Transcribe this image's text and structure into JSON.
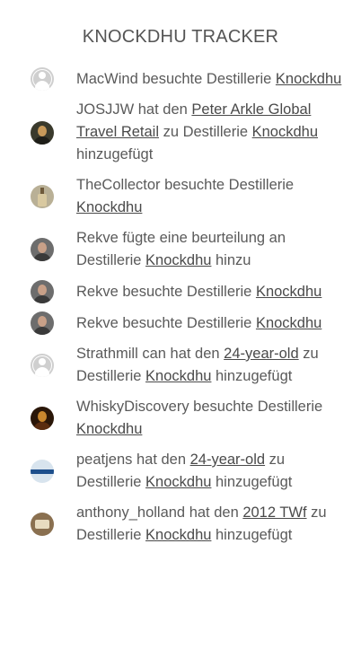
{
  "title": "KNOCKDHU TRACKER",
  "colors": {
    "title": "#555555",
    "text": "#5a5a5a",
    "link": "#4a4a4a",
    "default_avatar": "#cfcfcf"
  },
  "items": [
    {
      "avatar": "default-user-icon",
      "t1": "MacWind besuchte Destillerie ",
      "l1": "Knockdhu",
      "t2": "",
      "l2": "",
      "t3": ""
    },
    {
      "avatar": "user-photo",
      "t1": "JOSJJW hat den ",
      "l1": "Peter Arkle Global Travel Retail",
      "t2": " zu Destillerie ",
      "l2": "Knockdhu",
      "t3": " hinzugefügt"
    },
    {
      "avatar": "bottle-photo",
      "t1": "TheCollector besuchte Destillerie ",
      "l1": "Knockdhu",
      "t2": "",
      "l2": "",
      "t3": ""
    },
    {
      "avatar": "user-photo",
      "t1": "Rekve fügte eine beurteilung an Destillerie ",
      "l1": "Knockdhu",
      "t2": " hinzu",
      "l2": "",
      "t3": ""
    },
    {
      "avatar": "user-photo",
      "t1": "Rekve besuchte Destillerie ",
      "l1": "Knockdhu",
      "t2": "",
      "l2": "",
      "t3": ""
    },
    {
      "avatar": "user-photo",
      "t1": "Rekve besuchte Destillerie ",
      "l1": "Knockdhu",
      "t2": "",
      "l2": "",
      "t3": ""
    },
    {
      "avatar": "default-user-icon",
      "t1": "Strathmill can hat den ",
      "l1": "24-year-old",
      "t2": " zu Destillerie ",
      "l2": "Knockdhu",
      "t3": " hinzugefügt"
    },
    {
      "avatar": "user-photo",
      "t1": "WhiskyDiscovery besuchte Destillerie ",
      "l1": "Knockdhu",
      "t2": "",
      "l2": "",
      "t3": ""
    },
    {
      "avatar": "car-photo",
      "t1": "peatjens hat den ",
      "l1": "24-year-old",
      "t2": " zu Destillerie ",
      "l2": "Knockdhu",
      "t3": " hinzugefügt"
    },
    {
      "avatar": "label-photo",
      "t1": "anthony_holland hat den ",
      "l1": "2012 TWf",
      "t2": " zu Destillerie ",
      "l2": "Knockdhu",
      "t3": " hinzugefügt"
    }
  ]
}
